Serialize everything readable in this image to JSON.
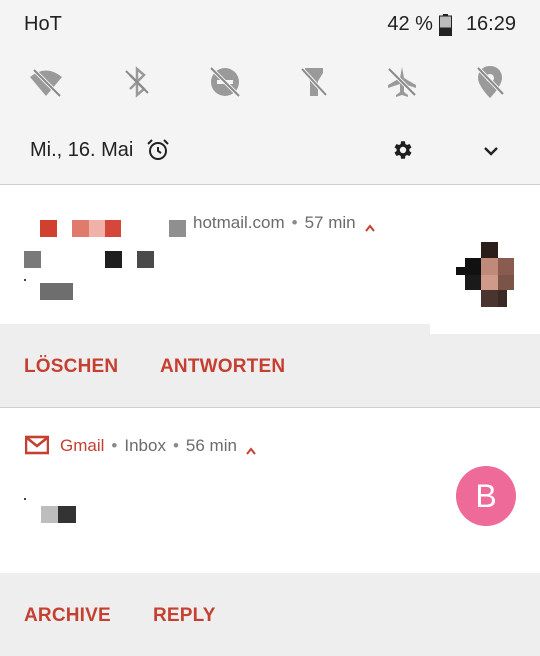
{
  "status_bar": {
    "carrier": "HoT",
    "battery_percent": "42 %",
    "time": "16:29",
    "battery_level": 0.42,
    "battery_icon": "battery-icon"
  },
  "quick_settings": [
    {
      "name": "wifi-off-icon"
    },
    {
      "name": "bluetooth-off-icon"
    },
    {
      "name": "do-not-disturb-off-icon"
    },
    {
      "name": "flashlight-off-icon"
    },
    {
      "name": "airplane-mode-off-icon"
    },
    {
      "name": "location-off-icon"
    }
  ],
  "date_row": {
    "date": "Mi., 16. Mai",
    "alarm_icon": "alarm-icon",
    "settings_icon": "gear-icon",
    "expand_icon": "chevron-down-icon"
  },
  "notifications": [
    {
      "header": "hotmail.com",
      "time": "57 min",
      "actions": [
        "LÖSCHEN",
        "ANTWORTEN"
      ]
    },
    {
      "app": "Gmail",
      "account": "Inbox",
      "time": "56 min",
      "avatar_letter": "B",
      "actions": [
        "ARCHIVE",
        "REPLY"
      ]
    }
  ],
  "colors": {
    "accent": "#c64032",
    "avatar_b": "#ee6a98",
    "shade_bg": "#f4f4f4",
    "card_bg": "#ffffff",
    "action_bg": "#eeeeee"
  },
  "separator": "•"
}
